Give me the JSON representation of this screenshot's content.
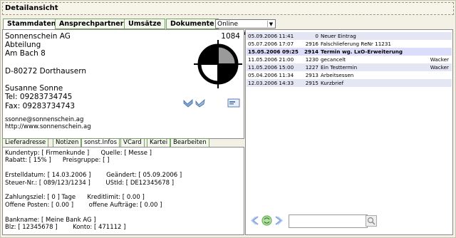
{
  "window": {
    "title": "Detailansicht"
  },
  "tabs": [
    {
      "label": "Stammdaten",
      "active": true
    },
    {
      "label": "Ansprechpartner",
      "active": false
    },
    {
      "label": "Umsätze",
      "active": false
    },
    {
      "label": "Dokumente",
      "active": false
    }
  ],
  "help_select": {
    "value": "Online Kundenhilfe"
  },
  "contact": {
    "company": "Sonnenschein AG",
    "department": "Abteilung",
    "street": "Am Bach 8",
    "city": "D-80272 Dorthausern",
    "person": "Susanne Sonne",
    "tel": "Tel: 09283734745",
    "fax": "Fax: 09283734743",
    "email": "ssonne@sonnenschein.ag",
    "web": "http://www.sonnenschein.ag",
    "number": "1084"
  },
  "subtabs": [
    {
      "label": "Lieferadresse",
      "active": false
    },
    {
      "label": "Notizen",
      "active": false
    },
    {
      "label": "sonst.Infos",
      "active": true
    },
    {
      "label": "VCard",
      "active": false
    },
    {
      "label": "Kartei",
      "active": false
    },
    {
      "label": "Bearbeiten",
      "active": false
    }
  ],
  "info_lines": {
    "l1": "Kundentyp: [ Firmenkunde ]      Quelle: [ Messe ]",
    "l2": "Rabatt: [ 15% ]      Preisgruppe: [ ]",
    "l3": "",
    "l4": "Erstelldatum: [ 14.03.2006 ]        Geändert: [ 05.09.2006 ]",
    "l5": "Steuer-Nr.: [ 089/123/1234 ]        UStId: [ DE12345678 ]",
    "l6": "",
    "l7": "Zahlungsziel: [ 0 ] Tage      Kreditlimit: [ 0.00 ]",
    "l8": "Offene Posten: [ 0.00 ]        offene Aufträge: [ 0.00 ]",
    "l9": "",
    "l10": "Bankname: [ Meine Bank AG ]",
    "l11": "Blz: [ 12345678 ]        Konto: [ 471112 ]"
  },
  "history": [
    {
      "date": "05.09.2006 11:41",
      "num": "0",
      "text": "Neuer Eintrag",
      "user": "",
      "style": "alt"
    },
    {
      "date": "05.07.2006 17:07",
      "num": "2916",
      "text": "Falschlieferung ReNr 11231",
      "user": "",
      "style": ""
    },
    {
      "date": "15.05.2006 09:25",
      "num": "2914",
      "text": "Termin wg. LxO-Erweiterung",
      "user": "",
      "style": "sel bold"
    },
    {
      "date": "11.05.2006 21:00",
      "num": "1230",
      "text": "gecancelt",
      "user": "Wacker",
      "style": ""
    },
    {
      "date": "11.05.2006 15:00",
      "num": "1227",
      "text": "Ein Testtermin",
      "user": "Wacker",
      "style": "alt"
    },
    {
      "date": "05.04.2006 11:34",
      "num": "2913",
      "text": "Arbeitsessen",
      "user": "",
      "style": ""
    },
    {
      "date": "12.03.2006 14:33",
      "num": "2915",
      "text": "Kurzbrief",
      "user": "",
      "style": "alt"
    }
  ],
  "search": {
    "value": ""
  }
}
